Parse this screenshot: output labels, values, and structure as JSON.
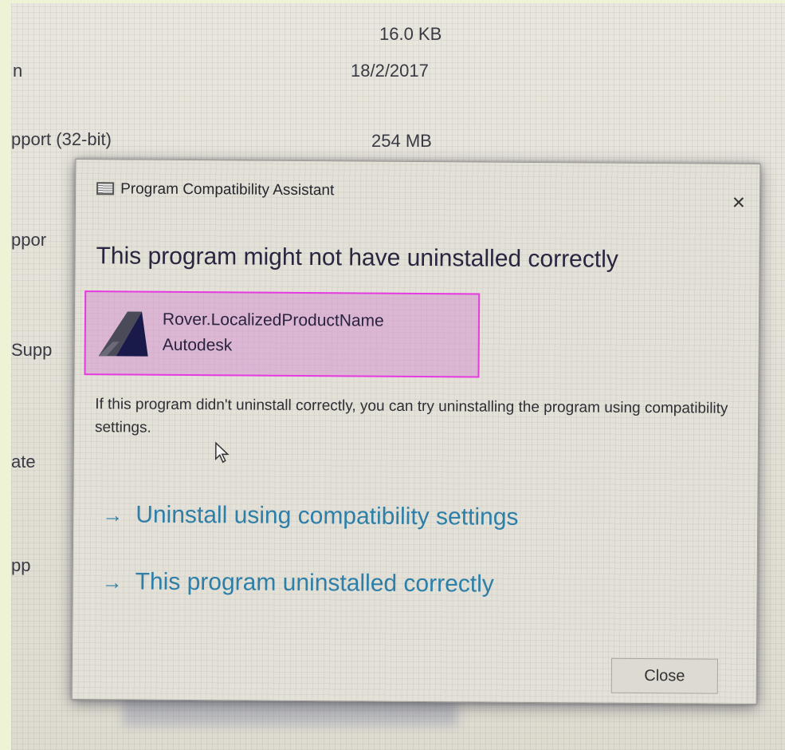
{
  "background": {
    "size_value": "16.0 KB",
    "date_value": "18/2/2017",
    "row_fragment_1": "n",
    "row_fragment_2": "pport (32-bit)",
    "size_value_2": "254 MB",
    "row_fragment_3": "ppor",
    "row_fragment_4": "Supp",
    "row_fragment_5": "ate",
    "row_fragment_6": "pp"
  },
  "dialog": {
    "title": "Program Compatibility Assistant",
    "close_icon": "close-icon",
    "close_glyph": "×",
    "heading": "This program might not have uninstalled correctly",
    "program": {
      "name": "Rover.LocalizedProductName",
      "publisher": "Autodesk",
      "icon": "autodesk-logo-icon"
    },
    "description": "If this program didn't uninstall correctly, you can try uninstalling the program using compatibility settings.",
    "links": [
      {
        "arrow": "→",
        "label": "Uninstall using compatibility settings"
      },
      {
        "arrow": "→",
        "label": "This program uninstalled correctly"
      }
    ],
    "close_button": "Close"
  },
  "colors": {
    "link": "#2d7fa8",
    "highlight_fill": "#d696d2",
    "highlight_border": "#e63be0",
    "heading": "#2a2540"
  }
}
